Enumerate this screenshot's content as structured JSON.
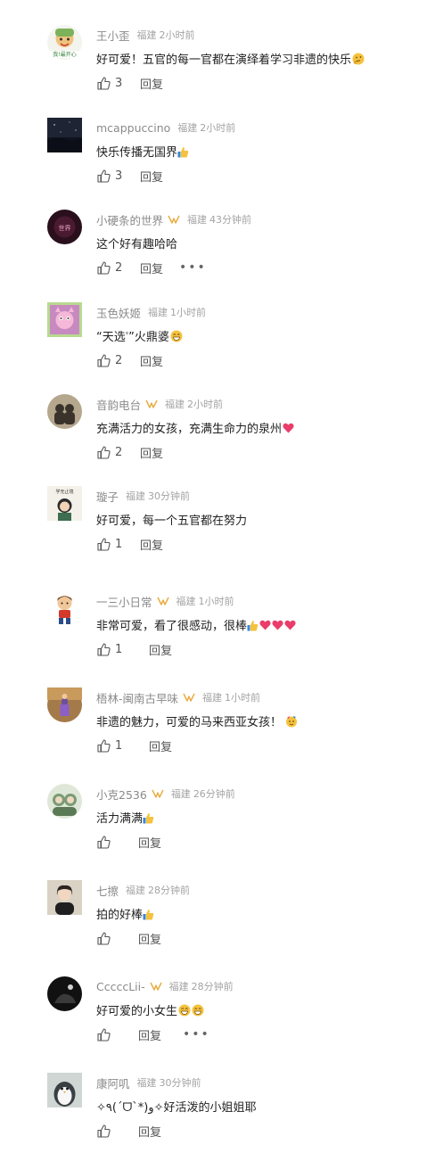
{
  "comments": [
    {
      "name": "王小歪",
      "vip": false,
      "location": "福建",
      "time": "2小时前",
      "text": "好可爱！五官的每一官都在演绎着学习非遗的快乐",
      "emoji": [
        "think"
      ],
      "likes": "3",
      "reply": "回复",
      "avatar_color": "#7cb25a",
      "avatar_label": "我!最开心"
    },
    {
      "name": "mcappuccino",
      "vip": false,
      "location": "福建",
      "time": "2小时前",
      "text": "快乐传播无国界",
      "emoji": [
        "thumb"
      ],
      "likes": "3",
      "reply": "回复",
      "avatar_color": "#1e2433"
    },
    {
      "name": "小硬条的世界",
      "vip": true,
      "location": "福建",
      "time": "43分钟前",
      "text": "这个好有趣哈哈",
      "emoji": [],
      "likes": "2",
      "reply": "回复",
      "more": "•••",
      "avatar_color": "#2a0f1c",
      "avatar_label": "世界"
    },
    {
      "name": "玉色妖姬",
      "vip": false,
      "location": "福建",
      "time": "1小时前",
      "text_parts": [
        "“天选",
        "”火鼎婆"
      ],
      "emoji": [
        "grin"
      ],
      "likes": "2",
      "reply": "回复",
      "avatar_color": "#c78ac0"
    },
    {
      "name": "音韵电台",
      "vip": true,
      "location": "福建",
      "time": "2小时前",
      "text": "充满活力的女孩，充满生命力的泉州",
      "emoji": [
        "heart"
      ],
      "likes": "2",
      "reply": "回复",
      "avatar_color": "#8a7d6a"
    },
    {
      "name": "璇子",
      "vip": false,
      "location": "福建",
      "time": "30分钟前",
      "text": "好可爱，每一个五官都在努力",
      "emoji": [],
      "likes": "1",
      "reply": "回复",
      "avatar_color": "#f3f1ea",
      "avatar_label": "学无止境"
    },
    {
      "name": "一三小日常",
      "vip": true,
      "location": "福建",
      "time": "1小时前",
      "text": "非常可爱，看了很感动，很棒",
      "emoji": [
        "thumb",
        "heart",
        "heart",
        "heart"
      ],
      "likes": "1",
      "reply": "回复",
      "avatar_color": "#ffffff"
    },
    {
      "name": "梧林-闽南古早味",
      "vip": true,
      "location": "福建",
      "time": "1小时前",
      "text": "非遗的魅力，可爱的马来西亚女孩！",
      "emoji": [
        "party"
      ],
      "likes": "1",
      "reply": "回复",
      "avatar_color": "#a47a4a"
    },
    {
      "name": "小克2536",
      "vip": true,
      "location": "福建",
      "time": "26分钟前",
      "text": "活力满满",
      "emoji": [
        "thumb"
      ],
      "likes": "",
      "reply": "回复",
      "avatar_color": "#9db59a"
    },
    {
      "name": "七擦",
      "vip": false,
      "location": "福建",
      "time": "28分钟前",
      "text": "拍的好棒",
      "emoji": [
        "thumb"
      ],
      "likes": "",
      "reply": "回复",
      "avatar_color": "#d9d2c5"
    },
    {
      "name": "CccccLii-",
      "vip": true,
      "location": "福建",
      "time": "28分钟前",
      "text": "好可爱的小女生",
      "emoji": [
        "grin",
        "grin"
      ],
      "likes": "",
      "reply": "回复",
      "more": "•••",
      "avatar_color": "#111111"
    },
    {
      "name": "康阿叽",
      "vip": false,
      "location": "福建",
      "time": "30分钟前",
      "text": "✧٩(ˊᗜˋ*)و✧好活泼的小姐姐耶",
      "emoji": [],
      "likes": "",
      "reply": "回复",
      "avatar_color": "#cfd6d4"
    }
  ]
}
